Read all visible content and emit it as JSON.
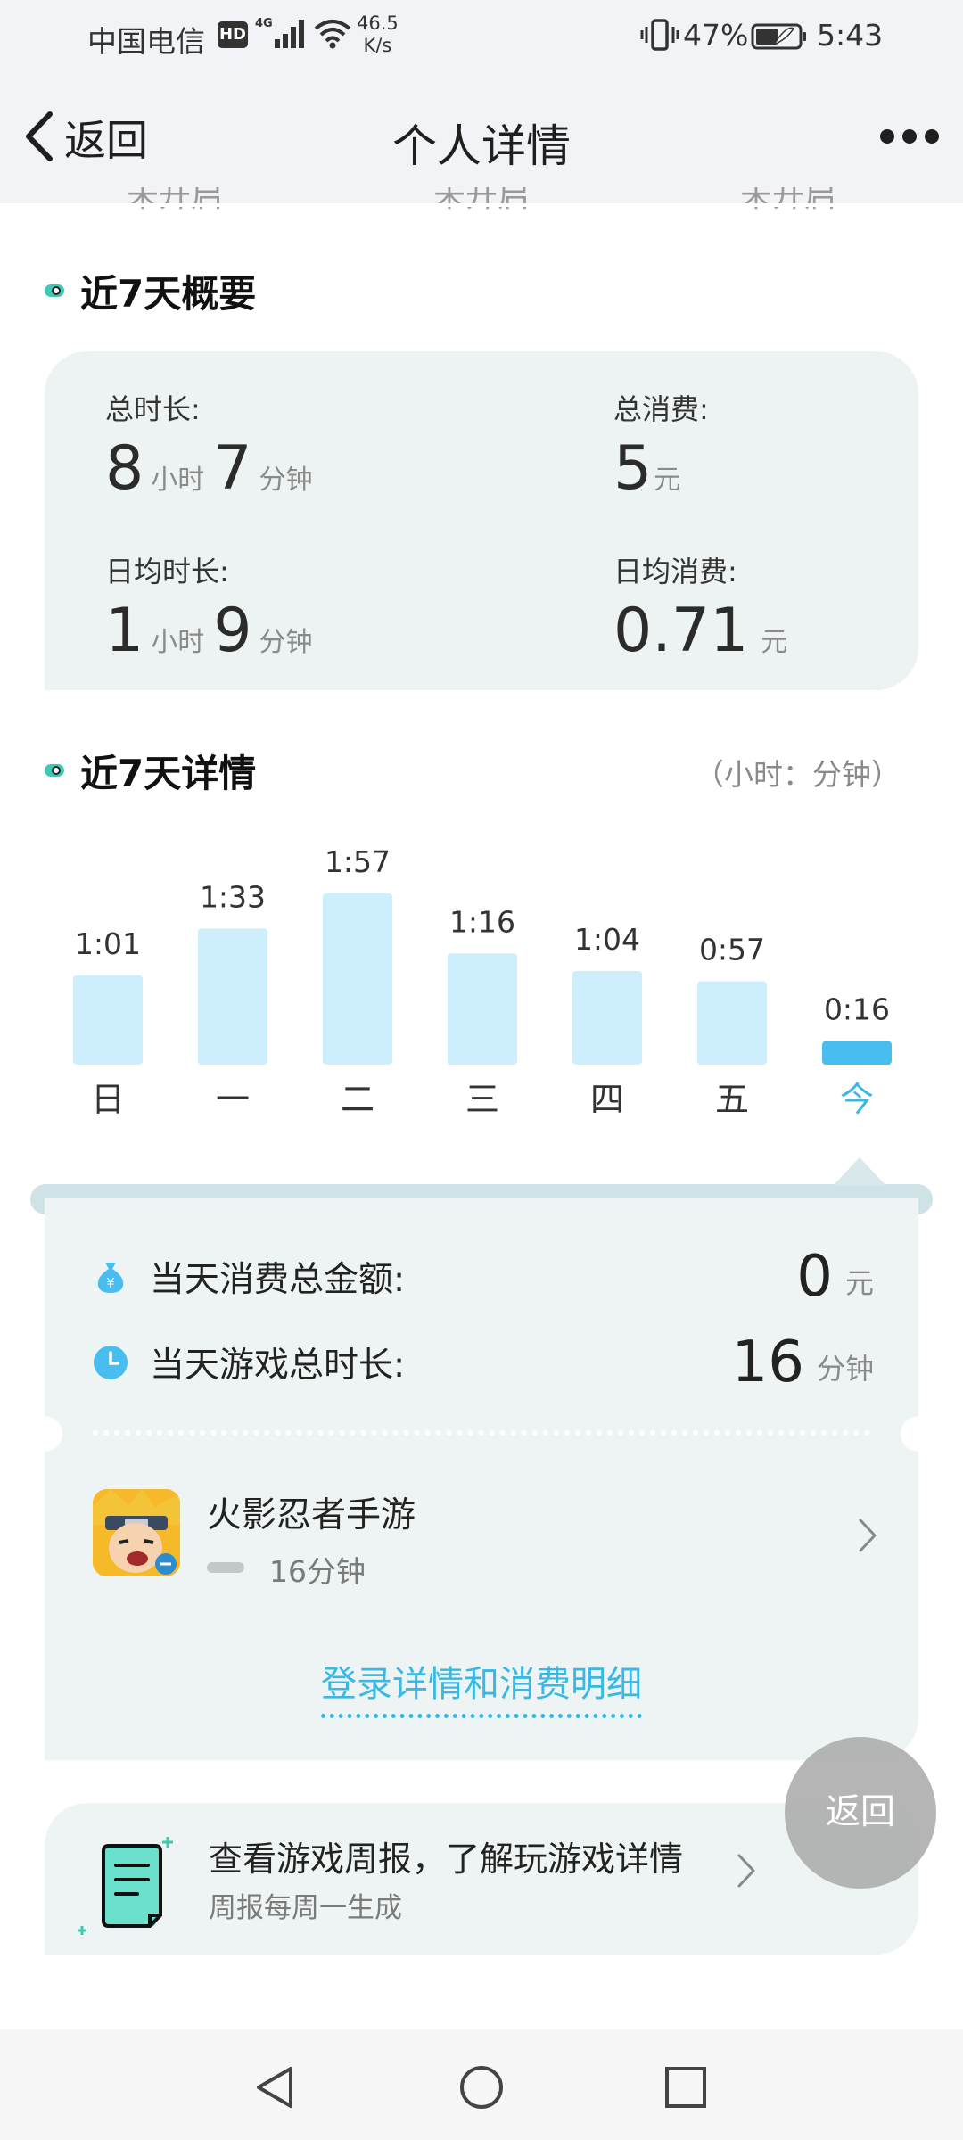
{
  "status_bar": {
    "carrier": "中国电信",
    "hd": "HD",
    "speed_value": "46.5",
    "speed_unit": "K/s",
    "battery": "47%",
    "time": "5:43"
  },
  "nav": {
    "back_label": "返回",
    "title": "个人详情"
  },
  "remnants": [
    "未开启",
    "未开启",
    "未开启"
  ],
  "summary": {
    "section_title": "近7天概要",
    "total_time": {
      "label": "总时长:",
      "hours": "8",
      "hour_unit": "小时",
      "minutes": "7",
      "minute_unit": "分钟"
    },
    "total_spend": {
      "label": "总消费:",
      "value": "5",
      "unit": "元"
    },
    "avg_time": {
      "label": "日均时长:",
      "hours": "1",
      "hour_unit": "小时",
      "minutes": "9",
      "minute_unit": "分钟"
    },
    "avg_spend": {
      "label": "日均消费:",
      "value": "0.71",
      "unit": "元"
    }
  },
  "details": {
    "section_title": "近7天详情",
    "unit_note": "（小时：分钟）"
  },
  "chart_data": {
    "type": "bar",
    "categories": [
      "日",
      "一",
      "二",
      "三",
      "四",
      "五",
      "今"
    ],
    "values": [
      61,
      93,
      117,
      76,
      64,
      57,
      16
    ],
    "labels": [
      "1:01",
      "1:33",
      "1:57",
      "1:16",
      "1:04",
      "0:57",
      "0:16"
    ],
    "selected_index": 6,
    "colors": {
      "bar": "#cdeefd",
      "selected_bar": "#47bdf0",
      "selected_label": "#38b8e2"
    }
  },
  "day_detail": {
    "spend_label": "当天消费总金额:",
    "spend_value": "0",
    "spend_unit": "元",
    "time_label": "当天游戏总时长:",
    "time_value": "16",
    "time_unit": "分钟",
    "game": {
      "name": "火影忍者手游",
      "duration": "16分钟"
    },
    "link": "登录详情和消费明细"
  },
  "report": {
    "title": "查看游戏周报，了解玩游戏详情",
    "subtitle": "周报每周一生成"
  },
  "float_back": "返回",
  "colors": {
    "accent": "#38b8e2",
    "card_bg": "#eef4f4",
    "section_dot": "#3ec9b4"
  }
}
